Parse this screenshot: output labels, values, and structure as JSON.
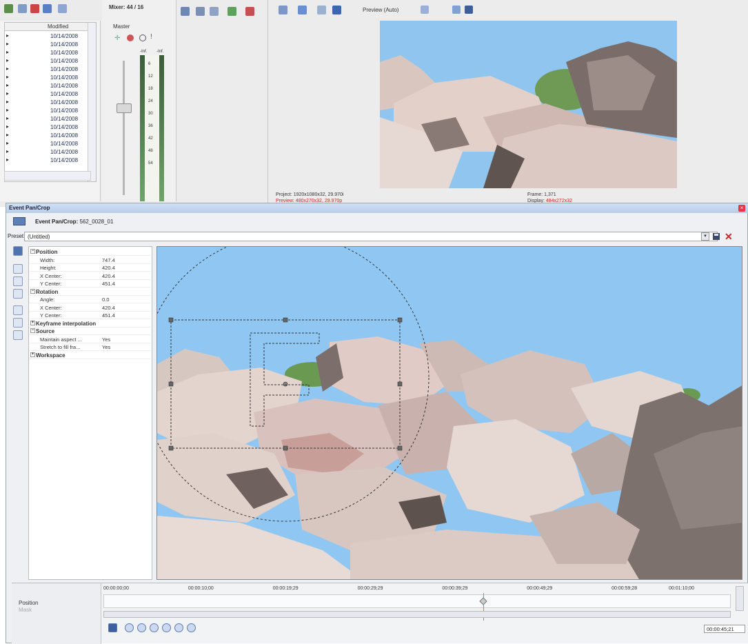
{
  "explorer": {
    "column_modified": "Modified",
    "rows": [
      "10/14/2008",
      "10/14/2008",
      "10/14/2008",
      "10/14/2008",
      "10/14/2008",
      "10/14/2008",
      "10/14/2008",
      "10/14/2008",
      "10/14/2008",
      "10/14/2008",
      "10/14/2008",
      "10/14/2008",
      "10/14/2008",
      "10/14/2008",
      "10/14/2008",
      "10/14/2008"
    ]
  },
  "mixer": {
    "title": "Mixer: 44 / 16",
    "master_label": "Master",
    "meter_ticks": [
      "-Inf.",
      "-Inf.",
      "6",
      "12",
      "18",
      "24",
      "30",
      "36",
      "42",
      "48",
      "54"
    ]
  },
  "preview": {
    "mode_label": "Preview (Auto)",
    "project_label": "Project:",
    "project_value": "1920x1080x32, 29.970i",
    "preview_label": "Preview:",
    "preview_value": "480x270x32, 29.970p",
    "frame_label": "Frame:",
    "frame_value": "1,371",
    "display_label": "Display:",
    "display_value": "484x272x32"
  },
  "pan_crop": {
    "window_title": "Event Pan/Crop",
    "header_prefix": "Event Pan/Crop:",
    "header_event": "562_0028_01",
    "preset_label": "Preset:",
    "preset_value": "(Untitled)",
    "properties": [
      {
        "type": "group",
        "key": "Position",
        "expand": "−"
      },
      {
        "type": "item",
        "key": "Width:",
        "value": "747.4"
      },
      {
        "type": "item",
        "key": "Height:",
        "value": "420.4"
      },
      {
        "type": "item",
        "key": "X Center:",
        "value": "420.4"
      },
      {
        "type": "item",
        "key": "Y Center:",
        "value": "451.4"
      },
      {
        "type": "group",
        "key": "Rotation",
        "expand": "−"
      },
      {
        "type": "item",
        "key": "Angle:",
        "value": "0.0"
      },
      {
        "type": "item",
        "key": "X Center:",
        "value": "420.4"
      },
      {
        "type": "item",
        "key": "Y Center:",
        "value": "451.4"
      },
      {
        "type": "group",
        "key": "Keyframe interpolation",
        "expand": "+"
      },
      {
        "type": "group",
        "key": "Source",
        "expand": "−"
      },
      {
        "type": "item",
        "key": "Maintain aspect ...",
        "value": "Yes"
      },
      {
        "type": "item",
        "key": "Stretch to fill fra...",
        "value": "Yes"
      },
      {
        "type": "group",
        "key": "Workspace",
        "expand": "+"
      }
    ]
  },
  "timeline": {
    "track_position": "Position",
    "track_mask": "Mask",
    "ruler": [
      "00:00:00;00",
      "00:00:10;00",
      "00:00:19;29",
      "00:00:29;29",
      "00:00:39;29",
      "00:00:49;29",
      "00:00:59;28",
      "00:01:10;00"
    ],
    "current_time": "00:00:45;21"
  },
  "colors": {
    "sky": "#8fc7f2",
    "window_title_bar": "#b9cde8",
    "timeline_cursor": "#d08030",
    "delete_red": "#cc2222"
  }
}
